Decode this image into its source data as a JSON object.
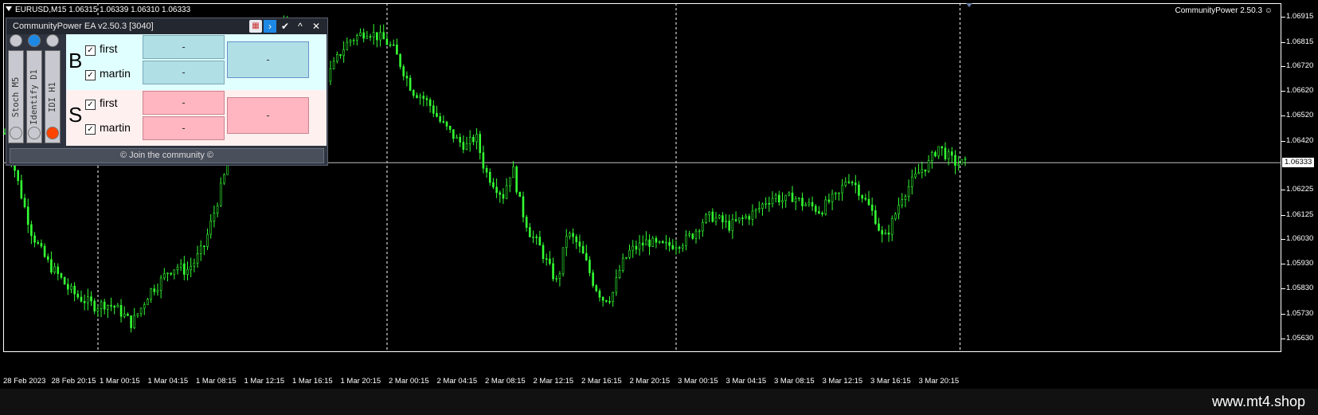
{
  "header": {
    "symbol_info": "EURUSD,M15  1.06315 1.06339 1.06310 1.06333",
    "ea_label": "CommunityPower 2.50.3 ☺"
  },
  "panel": {
    "title": "CommunityPower EA v2.50.3 [3040]",
    "buttons": {
      "check": "✔",
      "up": "^",
      "close": "✕",
      "arrow": "›",
      "calendar": "▦"
    },
    "indicators": [
      "Stoch M5",
      "Identify D1",
      "IDI H1"
    ],
    "top_circles": [
      "#c8c8d0",
      "#1e88e5",
      "#c8c8d0"
    ],
    "bottom_circles": [
      "#c8c8d0",
      "#c8c8d0",
      "#ff4500"
    ],
    "buy": {
      "letter": "B",
      "first_label": "first",
      "martin_label": "martin",
      "first_value": "-",
      "martin_value": "-",
      "total_value": "-"
    },
    "sell": {
      "letter": "S",
      "first_label": "first",
      "martin_label": "martin",
      "first_value": "-",
      "martin_value": "-",
      "total_value": "-"
    },
    "join_text": "© Join the community ©"
  },
  "current_price": "1.06333",
  "watermark": "www.mt4.shop",
  "colors": {
    "candle": "#33ff33",
    "background": "#000000",
    "buy": "#b0e0e6",
    "sell": "#ffb6c1"
  },
  "chart_data": {
    "type": "line",
    "title": "",
    "xlabel": "",
    "ylabel": "",
    "ylim": [
      1.0558,
      1.0697
    ],
    "price_ticks": [
      1.06915,
      1.06815,
      1.0672,
      1.0662,
      1.0652,
      1.0642,
      1.06225,
      1.06125,
      1.0603,
      1.0593,
      1.0583,
      1.0573,
      1.0563
    ],
    "time_ticks": [
      "28 Feb 2023",
      "28 Feb 20:15",
      "1 Mar 00:15",
      "1 Mar 04:15",
      "1 Mar 08:15",
      "1 Mar 12:15",
      "1 Mar 16:15",
      "1 Mar 20:15",
      "2 Mar 00:15",
      "2 Mar 04:15",
      "2 Mar 08:15",
      "2 Mar 12:15",
      "2 Mar 16:15",
      "2 Mar 20:15",
      "3 Mar 00:15",
      "3 Mar 04:15",
      "3 Mar 08:15",
      "3 Mar 12:15",
      "3 Mar 16:15",
      "3 Mar 20:15"
    ],
    "day_separators": [
      "1 Mar 00:15",
      "2 Mar 00:15",
      "3 Mar 00:15",
      "3 Mar 20:15"
    ],
    "current_price": 1.06333,
    "series": [
      {
        "close": [
          1.0645,
          1.0632,
          1.0618,
          1.0605,
          1.0598,
          1.0592,
          1.0588,
          1.0583,
          1.058,
          1.0578,
          1.0576,
          1.0577,
          1.0576,
          1.0573,
          1.0569,
          1.0575,
          1.0582,
          1.0585,
          1.059,
          1.0592,
          1.059,
          1.0594,
          1.06,
          1.0612,
          1.0625,
          1.0638,
          1.065,
          1.066,
          1.0668,
          1.0675,
          1.0683,
          1.0688,
          1.0683,
          1.0678,
          1.067,
          1.0664,
          1.067,
          1.0677,
          1.0682,
          1.0684,
          1.0686,
          1.0684,
          1.0682,
          1.0678,
          1.067,
          1.0662,
          1.066,
          1.0656,
          1.065,
          1.0646,
          1.0642,
          1.064,
          1.0644,
          1.063,
          1.0625,
          1.062,
          1.0632,
          1.0615,
          1.0605,
          1.06,
          1.0592,
          1.0585,
          1.0605,
          1.0602,
          1.0595,
          1.0585,
          1.0579,
          1.058,
          1.0592,
          1.0598,
          1.06,
          1.0602,
          1.06,
          1.06,
          1.0601,
          1.0602,
          1.0605,
          1.061,
          1.0612,
          1.061,
          1.0608,
          1.061,
          1.0612,
          1.0614,
          1.0618,
          1.062,
          1.0618,
          1.062,
          1.0617,
          1.0616,
          1.0614,
          1.0618,
          1.062,
          1.0628,
          1.0624,
          1.0618,
          1.0612,
          1.0602,
          1.061,
          1.062,
          1.0625,
          1.063,
          1.0633,
          1.064,
          1.0636,
          1.0633,
          1.0633
        ]
      }
    ]
  }
}
